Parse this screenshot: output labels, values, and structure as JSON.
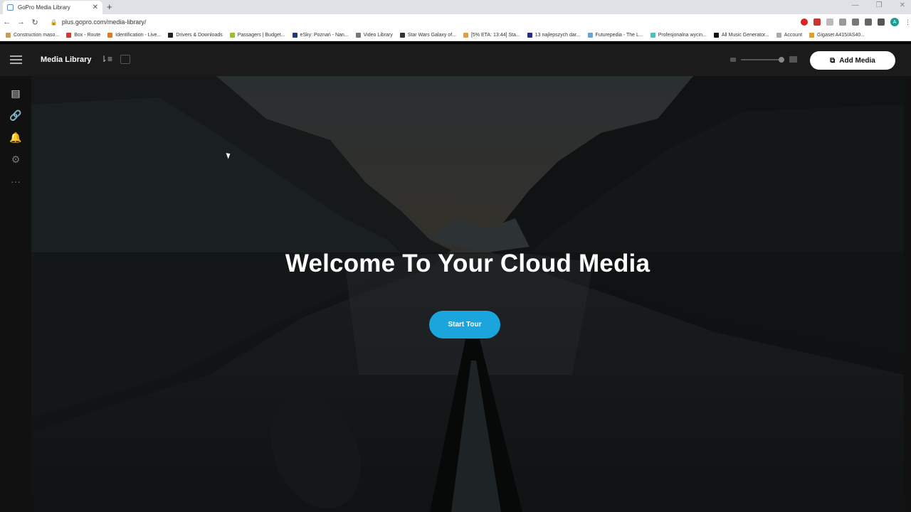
{
  "browser": {
    "tab_title": "GoPro Media Library",
    "tab_close": "✕",
    "new_tab": "+",
    "url": "plus.gopro.com/media-library/",
    "avatar_letter": "A",
    "window_controls": [
      "—",
      "❐",
      "✕"
    ],
    "bookmarks": [
      {
        "label": "Construction maso...",
        "color": "#c0a060"
      },
      {
        "label": "Box - Route",
        "color": "#d33"
      },
      {
        "label": "Identification - Live...",
        "color": "#e07a1f"
      },
      {
        "label": "Drivers & Downloads",
        "color": "#222"
      },
      {
        "label": "Passagers | Budget...",
        "color": "#9bbf2a"
      },
      {
        "label": "eSky: Poznań - Nan...",
        "color": "#1f3a7a"
      },
      {
        "label": "Video Library",
        "color": "#777"
      },
      {
        "label": "Star Wars Galaxy of...",
        "color": "#333"
      },
      {
        "label": "[5% ETA: 13:44] Sta...",
        "color": "#e0a040"
      },
      {
        "label": "13 najlepszych dar...",
        "color": "#2a2a8a"
      },
      {
        "label": "Futurepedia - The L...",
        "color": "#6aa3d8"
      },
      {
        "label": "Profesjonalna wycin...",
        "color": "#5bb"
      },
      {
        "label": "All Music Generator...",
        "color": "#111"
      },
      {
        "label": "Account",
        "color": "#aaa"
      },
      {
        "label": "Gigaset A415/AS40...",
        "color": "#e0a020"
      }
    ]
  },
  "app": {
    "title": "Media Library",
    "add_media_label": "Add Media",
    "sidebar_icons": [
      "media-icon",
      "link-icon",
      "bell-icon",
      "settings-icon",
      "more-icon"
    ],
    "sidebar_glyphs": [
      "▤",
      "🔗",
      "🔔",
      "⚙",
      "···"
    ]
  },
  "hero": {
    "headline": "Welcome To Your Cloud Media",
    "cta_label": "Start Tour",
    "cta_color": "#1aa6dc"
  }
}
